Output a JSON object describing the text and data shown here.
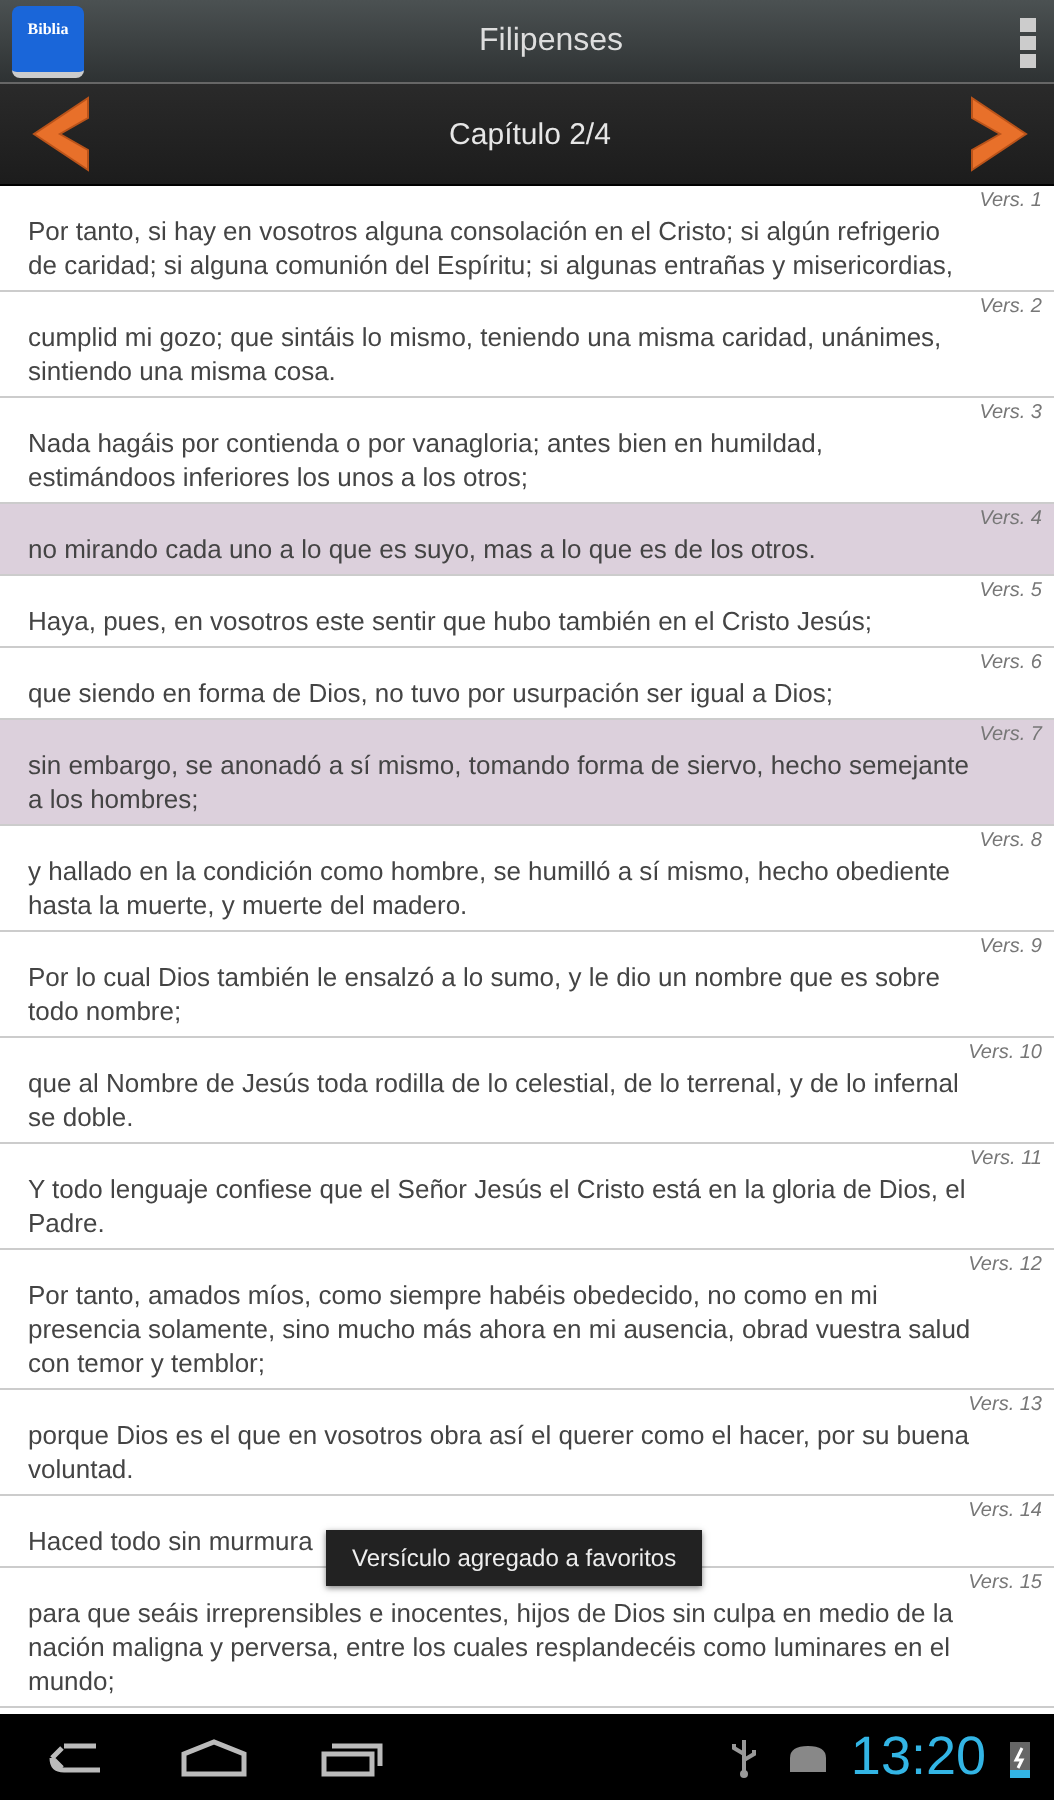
{
  "action_bar": {
    "app_icon_label": "Biblia",
    "title": "Filipenses"
  },
  "chapter_bar": {
    "title": "Capítulo 2/4"
  },
  "verses": [
    {
      "ref": "Vers. 1",
      "text": "Por tanto, si hay en vosotros alguna consolación en el Cristo; si algún refrigerio de caridad; si alguna comunión del Espíritu; si algunas entrañas y misericordias,",
      "selected": false
    },
    {
      "ref": "Vers. 2",
      "text": "cumplid mi gozo; que sintáis lo mismo, teniendo una misma caridad, unánimes, sintiendo una misma cosa.",
      "selected": false
    },
    {
      "ref": "Vers. 3",
      "text": "Nada hagáis por contienda o por vanagloria; antes bien en humildad, estimándoos inferiores los unos a los otros;",
      "selected": false
    },
    {
      "ref": "Vers. 4",
      "text": "no mirando cada uno a lo que es suyo, mas a lo que es de los otros.",
      "selected": true
    },
    {
      "ref": "Vers. 5",
      "text": "Haya, pues, en vosotros este sentir que hubo también en el Cristo Jesús;",
      "selected": false
    },
    {
      "ref": "Vers. 6",
      "text": "que siendo en forma de Dios, no tuvo por usurpación ser igual a Dios;",
      "selected": false
    },
    {
      "ref": "Vers. 7",
      "text": "sin embargo, se anonadó a sí mismo, tomando forma de siervo, hecho semejante a los hombres;",
      "selected": true
    },
    {
      "ref": "Vers. 8",
      "text": "y hallado en la condición como hombre, se humilló a sí mismo, hecho obediente hasta la muerte, y muerte del madero.",
      "selected": false
    },
    {
      "ref": "Vers. 9",
      "text": "Por lo cual Dios también le ensalzó a lo sumo, y le dio un nombre que es sobre todo nombre;",
      "selected": false
    },
    {
      "ref": "Vers. 10",
      "text": "que al Nombre de Jesús toda rodilla de lo celestial, de lo terrenal, y de lo infernal se doble.",
      "selected": false
    },
    {
      "ref": "Vers. 11",
      "text": "Y todo lenguaje confiese que el Señor Jesús el Cristo está en la gloria de Dios, el Padre.",
      "selected": false
    },
    {
      "ref": "Vers. 12",
      "text": "Por tanto, amados míos, como siempre habéis obedecido, no como en mi presencia solamente, sino mucho más ahora en mi ausencia, obrad vuestra salud con temor y temblor;",
      "selected": false
    },
    {
      "ref": "Vers. 13",
      "text": "porque Dios es el que en vosotros obra así el querer como el hacer, por su buena voluntad.",
      "selected": false
    },
    {
      "ref": "Vers. 14",
      "text": "Haced todo sin murmura",
      "selected": false
    },
    {
      "ref": "Vers. 15",
      "text": "para que seáis irreprensibles e inocentes, hijos de Dios sin culpa en medio de la nación maligna y perversa, entre los cuales resplandecéis como luminares en el mundo;",
      "selected": false
    }
  ],
  "toast": "Versículo agregado a favoritos",
  "system_bar": {
    "time": "13:20"
  }
}
